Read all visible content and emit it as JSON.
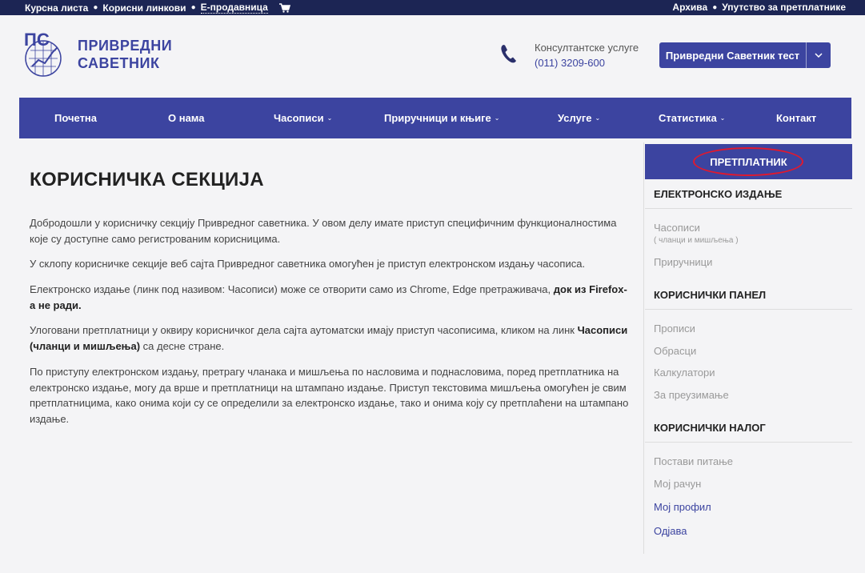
{
  "topbar": {
    "left_links": [
      "Курсна листа",
      "Корисни линкови",
      "Е-продавница"
    ],
    "right_links": [
      "Архива",
      "Упутство за претплатнике"
    ],
    "icon_cart": "cart-icon"
  },
  "header": {
    "logo_line1": "ПРИВРЕДНИ",
    "logo_line2": "САВЕТНИК",
    "consult_label": "Консултантске услуге",
    "phone": "(011) 3209-600",
    "user_button": "Привредни Саветник тест",
    "icon_phone": "phone-icon"
  },
  "nav": {
    "items": [
      "Почетна",
      "О нама",
      "Часописи",
      "Приручници и књиге",
      "Услуге",
      "Статистика",
      "Контакт"
    ],
    "chevron": "⌄"
  },
  "main": {
    "title": "КОРИСНИЧКА СЕКЦИЈА",
    "p1": "Добродошли у корисничку секцију Привредног саветника. У овом делу имате приступ специфичним функционалностима које су доступне само регистрованим корисницима.",
    "p2": "У склопу корисничке секције веб сајта Привредног саветника омогућен је приступ електронском издању часописа.",
    "p3_text": "Електронско издање (линк под називом: Часописи) може се отворити само из Chrome, Edge претраживача, ",
    "p3_bold": "док из Firefox-а не ради.",
    "p4_text": "Улоговани претплатници у оквиру корисничког дела сајта аутоматски имају приступ часописима, кликом на линк ",
    "p4_bold": "Часописи (чланци и мишљења)",
    "p4_end": " са десне стране.",
    "p5": "По приступу електронском издању, претрагу чланака и мишљења по насловима и поднасловима, поред претплатника на електронско издање, могу да врше и претплатници на штампано издање. Приступ текстовима мишљења омогућен је свим претплатницима, како онима који су се определили за електронско издање, тако и онима коју су претплаћени на штампано издање."
  },
  "sidebar": {
    "header": "ПРЕТПЛАТНИК",
    "section1": "ЕЛЕКТРОНСКО ИЗДАЊЕ",
    "s1_link1": "Часописи",
    "s1_link1_sub": "( чланци и мишљења )",
    "s1_link2": "Приручници",
    "section2": "КОРИСНИЧКИ ПАНЕЛ",
    "s2_links": [
      "Прописи",
      "Обрасци",
      "Калкулатори",
      "За преузимање"
    ],
    "section3": "КОРИСНИЧКИ НАЛОГ",
    "s3_links": [
      "Постави питање",
      "Мој рачун",
      "Мој профил",
      "Одјава"
    ]
  },
  "colors": {
    "brand": "#3c44a0",
    "topbar": "#1c2554",
    "annotation": "#e0192e"
  }
}
